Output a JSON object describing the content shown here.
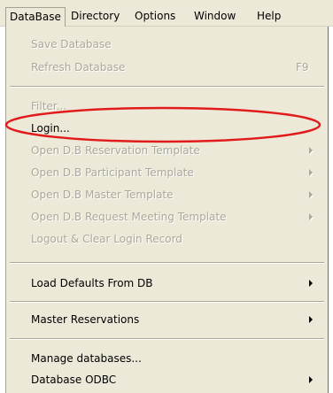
{
  "menubar": {
    "items": [
      {
        "label": "DataBase"
      },
      {
        "label": "Directory"
      },
      {
        "label": "Options"
      },
      {
        "label": "Window"
      },
      {
        "label": "Help"
      }
    ]
  },
  "menu": {
    "items": [
      {
        "label": "Save Database",
        "shortcut": "",
        "enabled": false
      },
      {
        "label": "Refresh Database",
        "shortcut": "F9",
        "enabled": false
      },
      {
        "label": "Filter...",
        "shortcut": "",
        "enabled": false
      },
      {
        "label": "Login...",
        "shortcut": "",
        "enabled": true
      },
      {
        "label": "Open D.B Reservation Template",
        "enabled": false,
        "submenu": true
      },
      {
        "label": "Open D.B Participant Template",
        "enabled": false,
        "submenu": true
      },
      {
        "label": "Open D.B Master Template",
        "enabled": false,
        "submenu": true
      },
      {
        "label": "Open D.B Request Meeting Template",
        "enabled": false,
        "submenu": true
      },
      {
        "label": "Logout & Clear Login Record",
        "enabled": false
      },
      {
        "label": "Load Defaults From DB",
        "enabled": true,
        "submenu": true
      },
      {
        "label": "Master Reservations",
        "enabled": true,
        "submenu": true
      },
      {
        "label": "Manage databases...",
        "enabled": true
      },
      {
        "label": "Database ODBC",
        "enabled": true,
        "submenu": true
      }
    ]
  },
  "annotation": {
    "shape": "ellipse",
    "color": "#e11b1b",
    "target": "Login..."
  }
}
